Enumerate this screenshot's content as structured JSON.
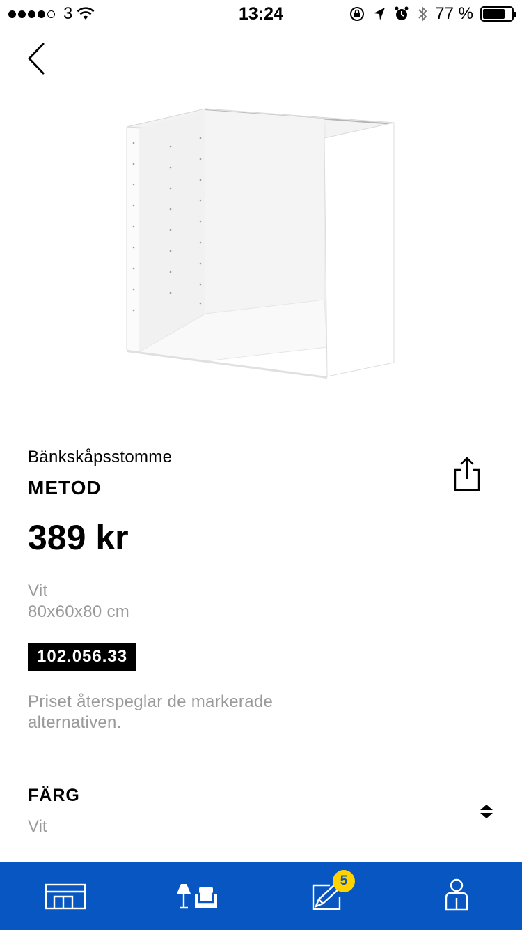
{
  "status_bar": {
    "carrier": "3",
    "time": "13:24",
    "battery": "77 %",
    "battery_level": 0.77
  },
  "icons": {
    "back": "chevron-left-icon",
    "share": "share-icon",
    "select": "up-down-arrows-icon"
  },
  "product": {
    "category": "Bänkskåpsstomme",
    "name": "METOD",
    "price": "389 kr",
    "color": "Vit",
    "dimensions": "80x60x80 cm",
    "article_number": "102.056.33",
    "price_note": "Priset återspeglar de markerade alternativen."
  },
  "options": {
    "color_title": "FÄRG",
    "color_value": "Vit"
  },
  "tabbar": {
    "tabs": [
      {
        "icon": "room-icon"
      },
      {
        "icon": "products-icon"
      },
      {
        "icon": "shopping-list-icon",
        "badge": "5"
      },
      {
        "icon": "profile-icon"
      }
    ]
  },
  "colors": {
    "tabbar": "#0756c1",
    "badge": "#ffd200",
    "muted_text": "#9a9a9a"
  }
}
